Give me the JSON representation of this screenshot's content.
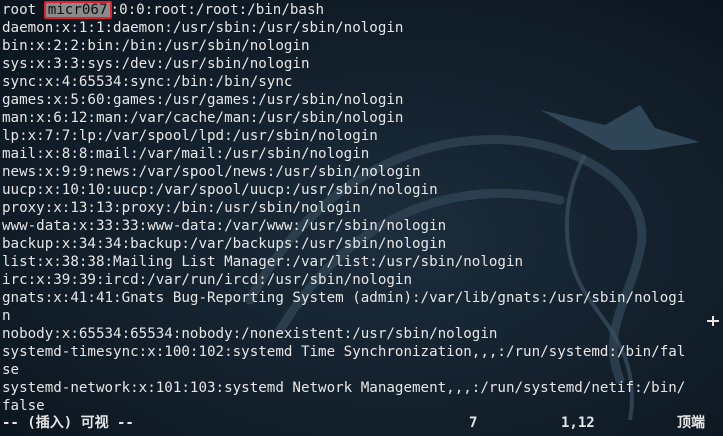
{
  "colors": {
    "background": "#0e1a25",
    "text": "#e6e6e6",
    "highlight_border": "#e0202a"
  },
  "file": {
    "first_line": {
      "prefix": "root",
      "highlighted": "micr067",
      "suffix": "0:0:root:/root:/bin/bash"
    },
    "lines": [
      "daemon:x:1:1:daemon:/usr/sbin:/usr/sbin/nologin",
      "bin:x:2:2:bin:/bin:/usr/sbin/nologin",
      "sys:x:3:3:sys:/dev:/usr/sbin/nologin",
      "sync:x:4:65534:sync:/bin:/bin/sync",
      "games:x:5:60:games:/usr/games:/usr/sbin/nologin",
      "man:x:6:12:man:/var/cache/man:/usr/sbin/nologin",
      "lp:x:7:7:lp:/var/spool/lpd:/usr/sbin/nologin",
      "mail:x:8:8:mail:/var/mail:/usr/sbin/nologin",
      "news:x:9:9:news:/var/spool/news:/usr/sbin/nologin",
      "uucp:x:10:10:uucp:/var/spool/uucp:/usr/sbin/nologin",
      "proxy:x:13:13:proxy:/bin:/usr/sbin/nologin",
      "www-data:x:33:33:www-data:/var/www:/usr/sbin/nologin",
      "backup:x:34:34:backup:/var/backups:/usr/sbin/nologin",
      "list:x:38:38:Mailing List Manager:/var/list:/usr/sbin/nologin",
      "irc:x:39:39:ircd:/var/run/ircd:/usr/sbin/nologin",
      "gnats:x:41:41:Gnats Bug-Reporting System (admin):/var/lib/gnats:/usr/sbin/nologi",
      "n",
      "nobody:x:65534:65534:nobody:/nonexistent:/usr/sbin/nologin",
      "systemd-timesync:x:100:102:systemd Time Synchronization,,,:/run/systemd:/bin/fal",
      "se",
      "systemd-network:x:101:103:systemd Network Management,,,:/run/systemd/netif:/bin/",
      "false"
    ]
  },
  "statusbar": {
    "mode": "-- (插入) 可视 --",
    "count": "7",
    "position": "1,12",
    "scroll": "顶端"
  }
}
